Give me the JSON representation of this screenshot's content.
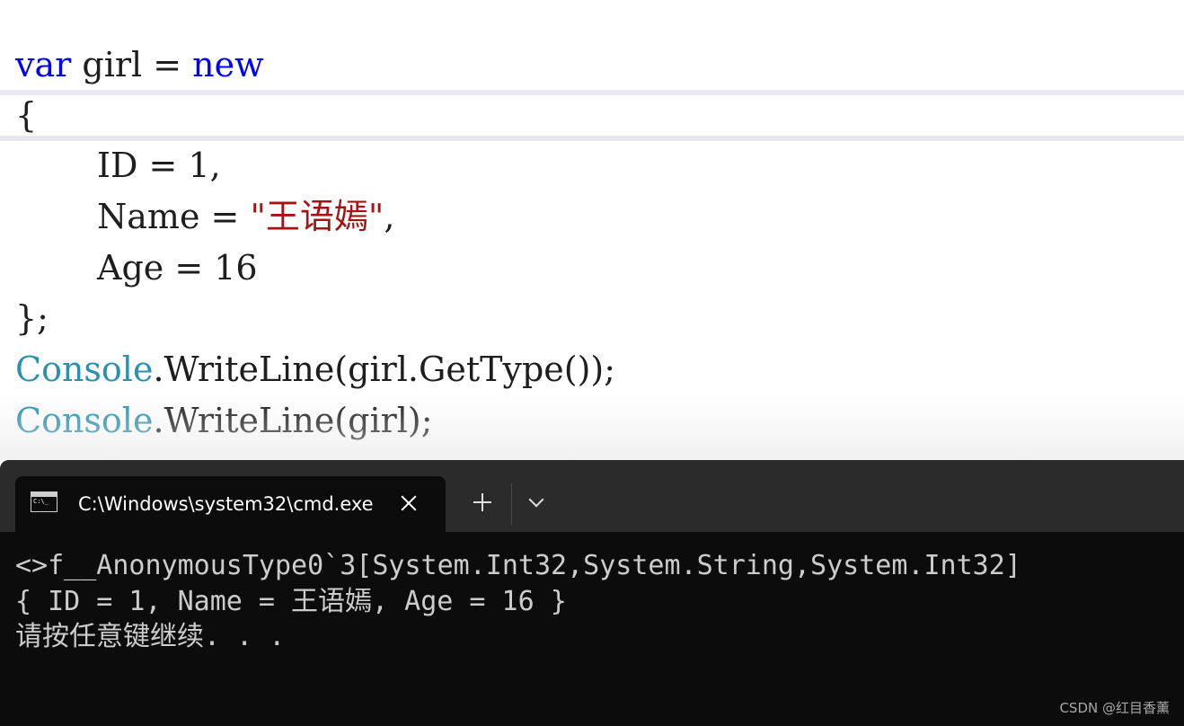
{
  "editor": {
    "line1": {
      "kw1": "var",
      "text1": " girl = ",
      "kw2": "new"
    },
    "line2": {
      "text": "{"
    },
    "line3": {
      "text": "ID = 1,"
    },
    "line4": {
      "text1": "Name = ",
      "str": "\"王语嫣\"",
      "text2": ","
    },
    "line5": {
      "text": "Age = 16"
    },
    "line6": {
      "text": "};"
    },
    "line7": {
      "type": "Console",
      "text": ".WriteLine(girl.GetType());"
    },
    "line8": {
      "type": "Console",
      "text": ".WriteLine(girl);"
    }
  },
  "terminal": {
    "tab_title": "C:\\Windows\\system32\\cmd.exe",
    "output_lines": [
      "<>f__AnonymousType0`3[System.Int32,System.String,System.Int32]",
      "{ ID = 1, Name = 王语嫣, Age = 16 }",
      "请按任意键继续. . ."
    ]
  },
  "watermark": "CSDN @红目香薰",
  "colors": {
    "keyword": "#0000ff",
    "type": "#2b91af",
    "string": "#a31515",
    "terminal_bg": "#0c0c0c",
    "tabbar_bg": "#2b2b2b",
    "terminal_text": "#cccccc"
  },
  "icons": [
    "cmd-icon",
    "close-icon",
    "plus-icon",
    "chevron-down-icon"
  ]
}
